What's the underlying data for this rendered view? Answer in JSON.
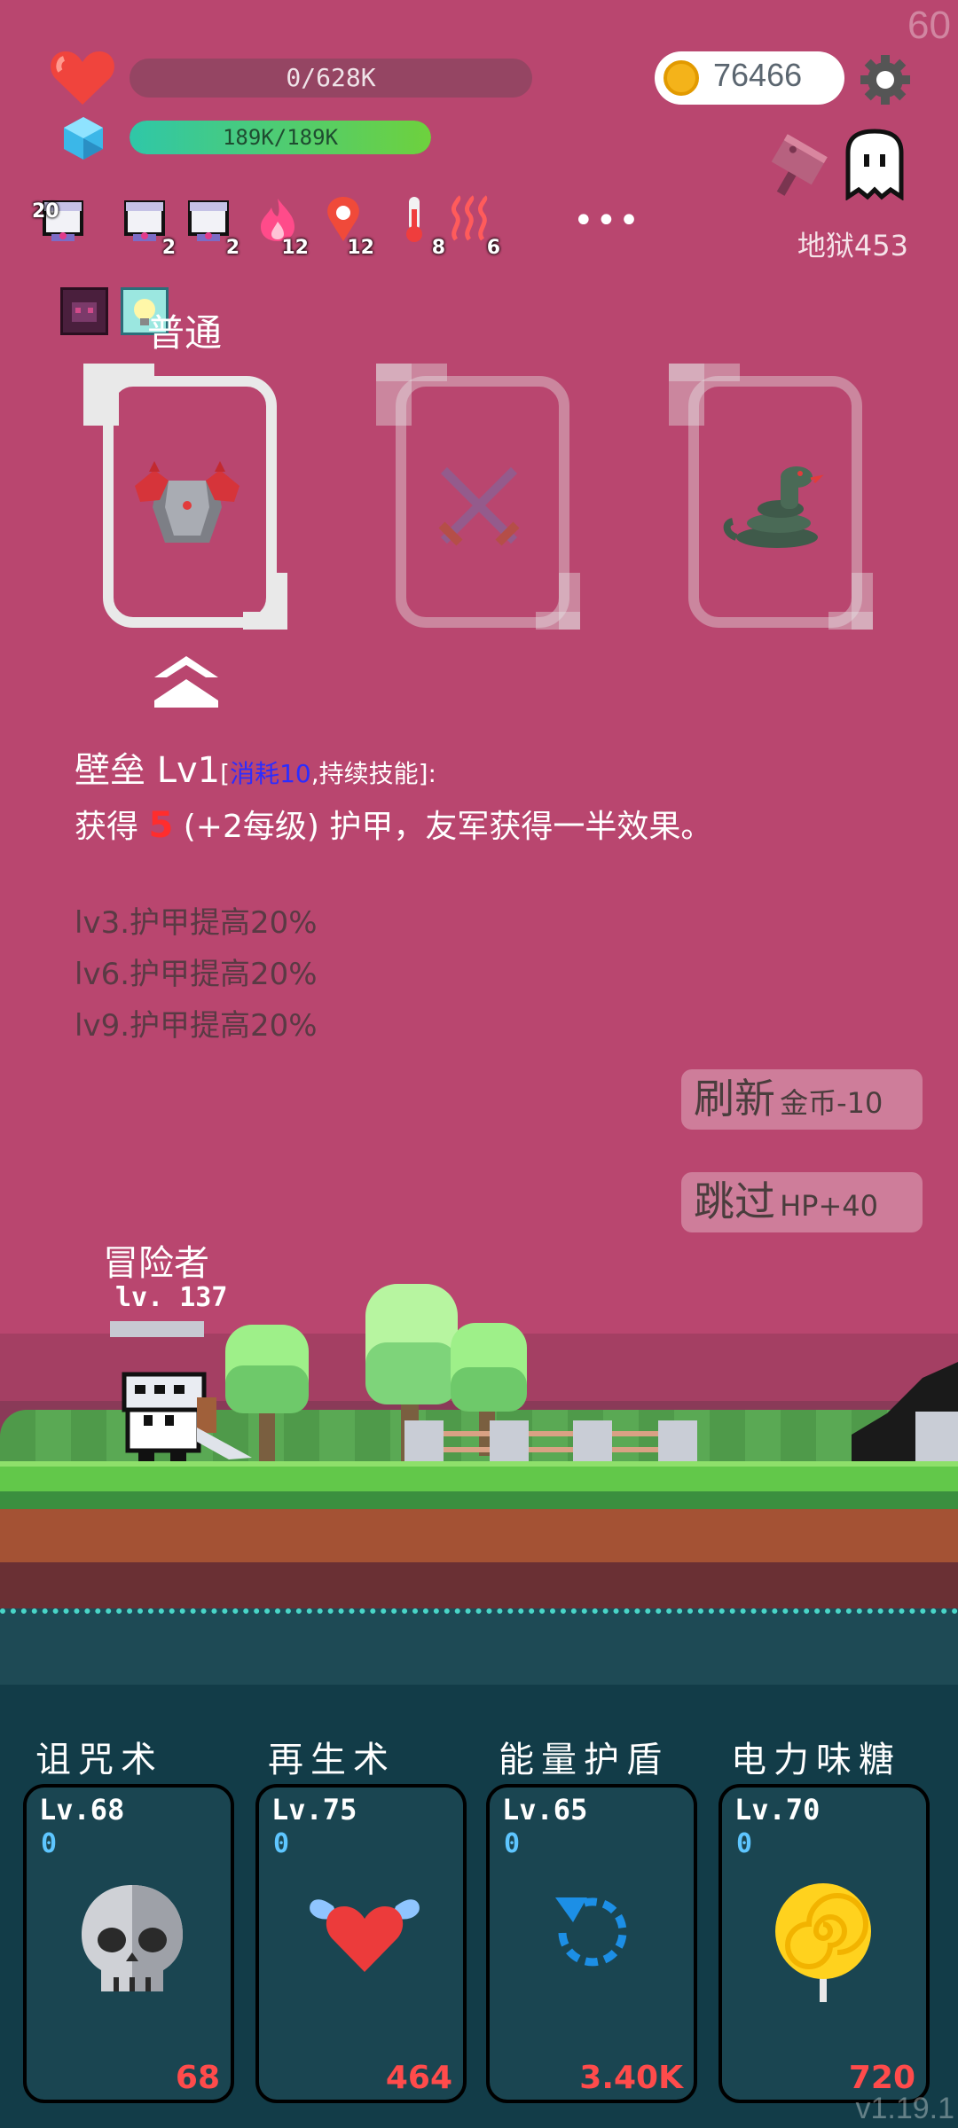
{
  "hud": {
    "fps": "60",
    "hp_text": "0/628K",
    "hp_fraction": 0,
    "mana_text": "189K/189K",
    "mana_fraction": 1.0,
    "gold": "76466",
    "stage": "地狱453"
  },
  "status_effects": [
    {
      "icon": "scroll-icon",
      "count": "20"
    },
    {
      "icon": "scroll-icon",
      "count": "2"
    },
    {
      "icon": "scroll-icon",
      "count": "2"
    },
    {
      "icon": "fire-icon",
      "count": "12"
    },
    {
      "icon": "location-pin-icon",
      "count": "12"
    },
    {
      "icon": "thermometer-icon",
      "count": "8"
    },
    {
      "icon": "heat-waves-icon",
      "count": "6"
    }
  ],
  "more_label": "•••",
  "rarity_label": "普通",
  "choices": [
    {
      "name": "armor-icon"
    },
    {
      "name": "crossed-swords-icon"
    },
    {
      "name": "snake-icon"
    }
  ],
  "skill": {
    "title": "壁垒 Lv1",
    "bracket_open": "[",
    "cost": "消耗10",
    "tag": ",持续技能]:",
    "desc_pre": "获得 ",
    "desc_num": "5",
    "desc_post": " (+2每级) 护甲，友军获得一半效果。",
    "levels": [
      "lv3.护甲提高20%",
      "lv6.护甲提高20%",
      "lv9.护甲提高20%"
    ]
  },
  "buttons": {
    "refresh": "刷新",
    "refresh_cost": "金币-10",
    "skip": "跳过",
    "skip_gain": "HP+40"
  },
  "player": {
    "name": "冒险者",
    "level": "lv. 137"
  },
  "skills": [
    {
      "title": "诅咒术",
      "level": "Lv.68",
      "charge": "0",
      "value": "68",
      "icon": "skull-icon"
    },
    {
      "title": "再生术",
      "level": "Lv.75",
      "charge": "0",
      "value": "464",
      "icon": "winged-heart-icon"
    },
    {
      "title": "能量护盾",
      "level": "Lv.65",
      "charge": "0",
      "value": "3.40K",
      "icon": "refresh-arrow-icon"
    },
    {
      "title": "电力味糖",
      "level": "Lv.70",
      "charge": "0",
      "value": "720",
      "icon": "lollipop-icon"
    }
  ],
  "version": "v1.19.1",
  "colors": {
    "background": "#b9466f",
    "panel": "#123c48",
    "mana": "#37c6a0",
    "cost_red": "#ff4b4b",
    "blue_text": "#2c2cff"
  }
}
